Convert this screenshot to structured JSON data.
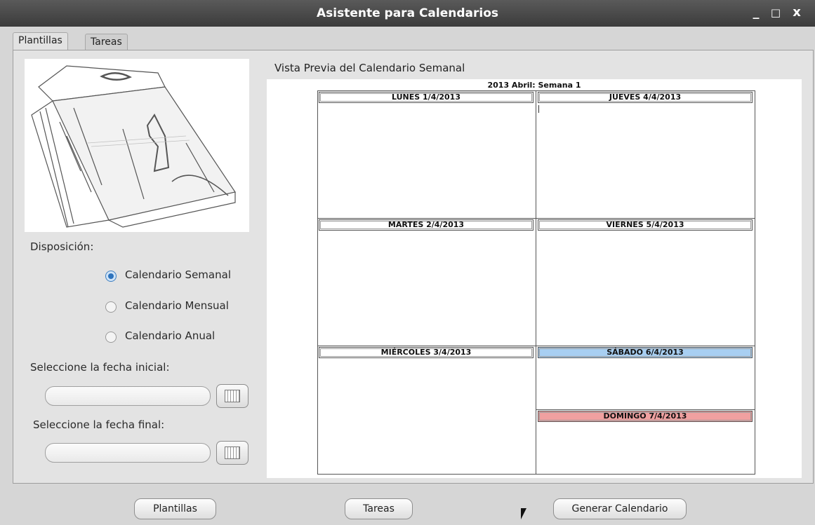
{
  "window": {
    "title": "Asistente para Calendarios",
    "minimize": "_",
    "maximize": "□",
    "close": "x"
  },
  "tabs": [
    {
      "label": "Plantillas",
      "active": true
    },
    {
      "label": "Tareas",
      "active": false
    }
  ],
  "left": {
    "disposition_label": "Disposición:",
    "options": [
      {
        "label": "Calendario Semanal",
        "selected": true
      },
      {
        "label": "Calendario Mensual",
        "selected": false
      },
      {
        "label": "Calendario Anual",
        "selected": false
      }
    ],
    "start_label": "Seleccione la fecha inicial:",
    "start_value": "",
    "end_label": "Seleccione la fecha final:",
    "end_value": ""
  },
  "preview": {
    "heading": "Vista Previa del Calendario Semanal",
    "title": "2013 Abril: Semana 1",
    "days": [
      "LUNES 1/4/2013",
      "MARTES 2/4/2013",
      "MIÉRCOLES 3/4/2013",
      "JUEVES 4/4/2013",
      "VIERNES 5/4/2013",
      "SÁBADO 6/4/2013",
      "DOMINGO 7/4/2013"
    ],
    "highlight_colors": {
      "saturday": "#a8cff2",
      "sunday": "#f0a0a0"
    }
  },
  "footer": {
    "plantillas": "Plantillas",
    "tareas": "Tareas",
    "generar": "Generar Calendario"
  },
  "thumbnail_icon": "tear-off-calendar-sketch"
}
